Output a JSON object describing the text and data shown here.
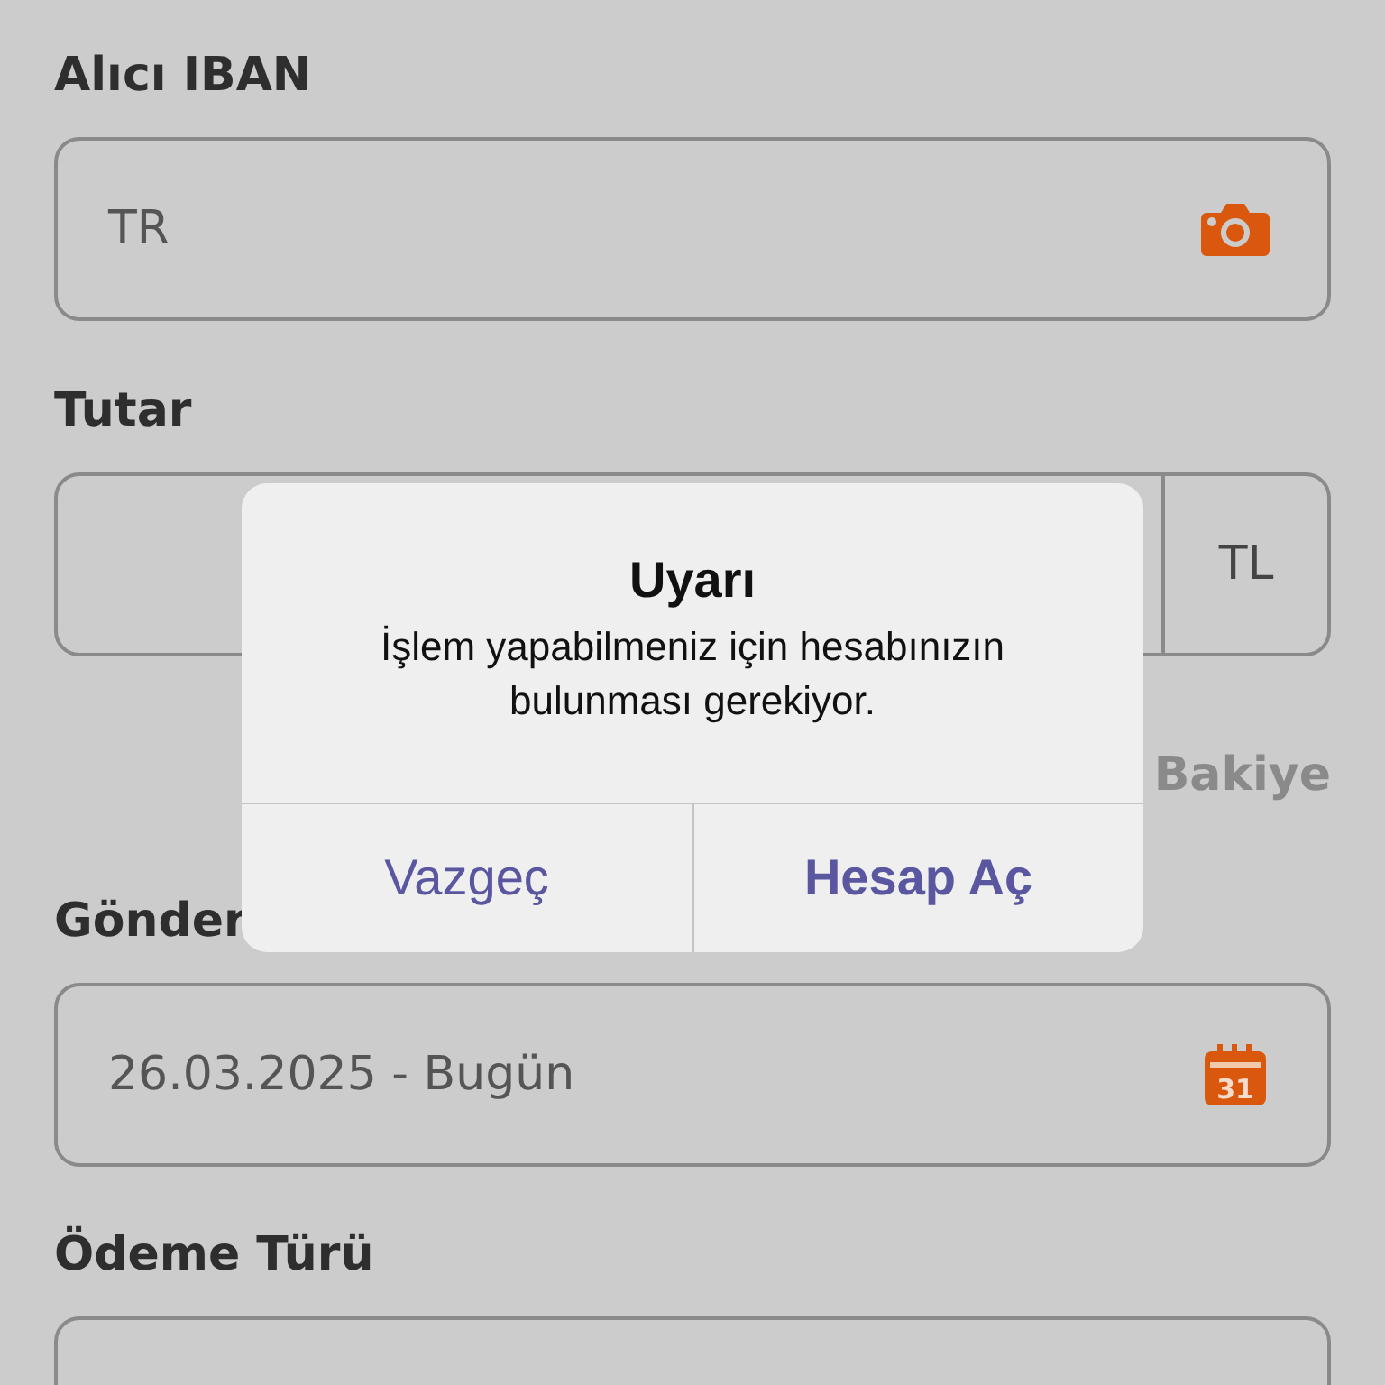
{
  "form": {
    "fields": [
      {
        "label": "Alıcı IBAN",
        "kind": "iban",
        "value": "TR"
      },
      {
        "label": "Tutar",
        "kind": "amount",
        "currency": "TL"
      },
      {
        "label": "Gönder",
        "kind": "date",
        "value": "26.03.2025 - Bugün",
        "calendar_day": "31"
      },
      {
        "label": "Ödeme Türü",
        "kind": "select"
      }
    ],
    "balance_label": "Bakiye"
  },
  "dialog": {
    "title": "Uyarı",
    "message": "İşlem yapabilmeniz için hesabınızın bulunması gerekiyor.",
    "buttons": [
      {
        "label": "Vazgeç",
        "primary": false
      },
      {
        "label": "Hesap Aç",
        "primary": true
      }
    ]
  }
}
